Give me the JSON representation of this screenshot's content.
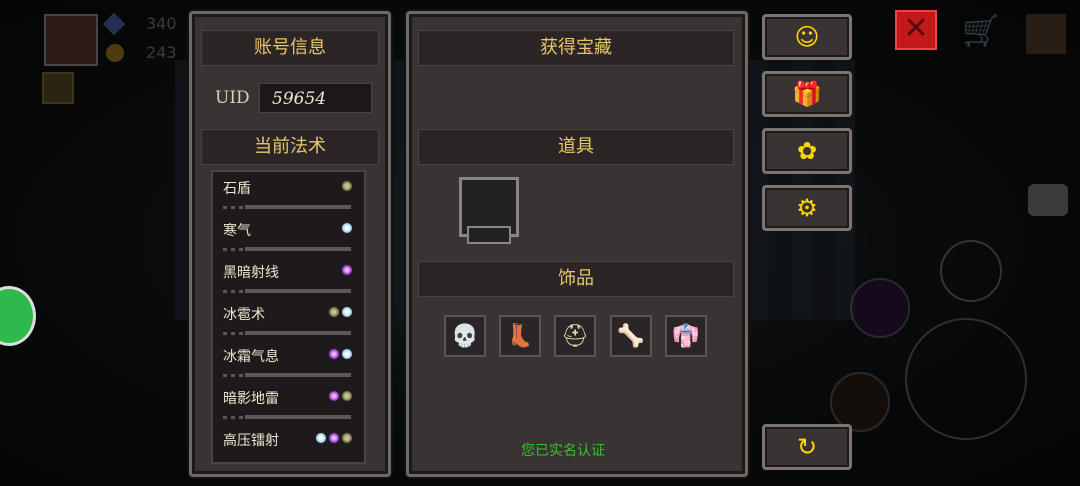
{
  "account": {
    "header": "账号信息",
    "uid_label": "UID",
    "uid_value": "59654"
  },
  "spells": {
    "header": "当前法术",
    "items": [
      {
        "name": "石盾",
        "elements": [
          "earth"
        ]
      },
      {
        "name": "寒气",
        "elements": [
          "ice"
        ]
      },
      {
        "name": "黑暗射线",
        "elements": [
          "dark"
        ]
      },
      {
        "name": "冰雹术",
        "elements": [
          "earth",
          "ice"
        ]
      },
      {
        "name": "冰霜气息",
        "elements": [
          "dark",
          "ice"
        ]
      },
      {
        "name": "暗影地雷",
        "elements": [
          "dark",
          "earth"
        ]
      },
      {
        "name": "高压镭射",
        "elements": [
          "ice",
          "dark",
          "earth"
        ]
      }
    ]
  },
  "treasure": {
    "header": "获得宝藏",
    "items_header": "道具",
    "accessories_header": "饰品",
    "accessories": [
      {
        "icon": "skull-necklace-icon",
        "glyph": "💀"
      },
      {
        "icon": "boot-icon",
        "glyph": "👢"
      },
      {
        "icon": "spiked-helmet-icon",
        "glyph": "⛑"
      },
      {
        "icon": "bone-charm-icon",
        "glyph": "🦴"
      },
      {
        "icon": "hooded-cloak-icon",
        "glyph": "👘"
      }
    ],
    "verify_text": "您已实名认证"
  },
  "hud": {
    "gems": "340",
    "coins": "243"
  },
  "side_buttons": [
    {
      "name": "support-button",
      "icon": "headset-icon",
      "glyph": "☺"
    },
    {
      "name": "gift-button",
      "icon": "gift-icon",
      "glyph": "🎁"
    },
    {
      "name": "bee-button",
      "icon": "bee-icon",
      "glyph": "✿"
    },
    {
      "name": "settings-button",
      "icon": "gear-icon",
      "glyph": "⚙"
    },
    {
      "name": "refresh-button",
      "icon": "refresh-icon",
      "glyph": "↻"
    }
  ],
  "colors": {
    "accent": "#e8c66a",
    "verify": "#35c22f",
    "button_icon": "#ffd600",
    "close": "#e02020"
  }
}
